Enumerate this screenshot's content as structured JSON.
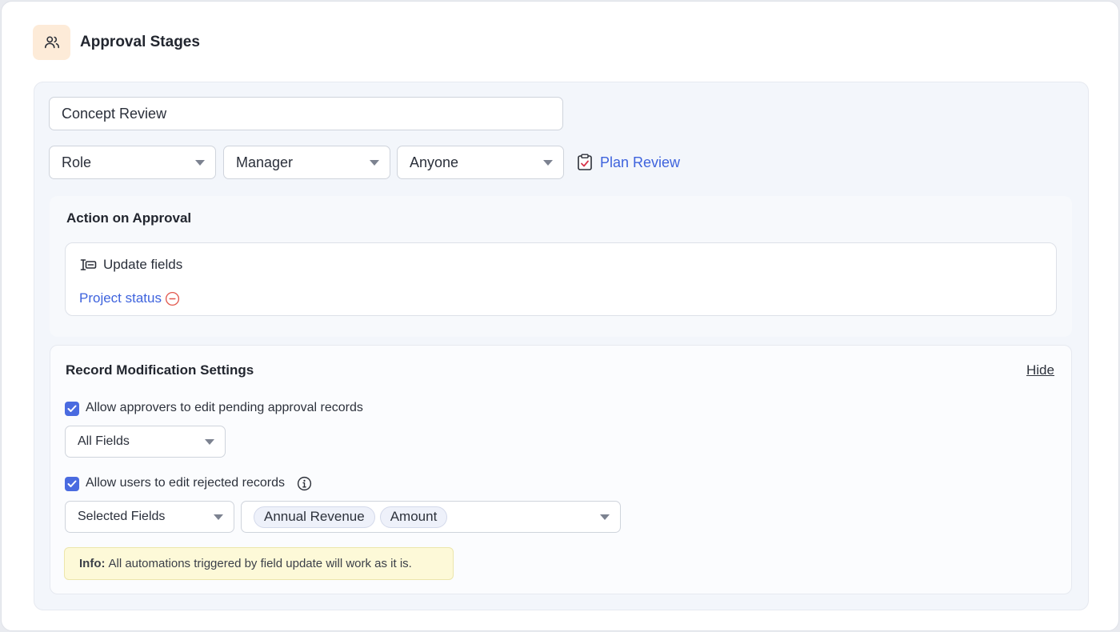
{
  "header": {
    "title": "Approval Stages",
    "icon": "users-icon"
  },
  "stage": {
    "name_value": "Concept Review",
    "approver_type": "Role",
    "approver_role": "Manager",
    "approval_rule": "Anyone",
    "plan_review_label": "Plan Review"
  },
  "action_on_approval": {
    "title": "Action on Approval",
    "action_label": "Update fields",
    "field_link": "Project status"
  },
  "record_modification": {
    "title": "Record Modification Settings",
    "hide_label": "Hide",
    "allow_approvers_label": "Allow approvers to edit pending approval records",
    "allow_approvers_checked": true,
    "approvers_fields": "All Fields",
    "allow_users_label": "Allow users to edit rejected records",
    "allow_users_checked": true,
    "users_fields_mode": "Selected Fields",
    "selected_fields": [
      "Annual Revenue",
      "Amount"
    ],
    "info_prefix": "Info:",
    "info_text": "All automations triggered by field update will work as it is."
  },
  "colors": {
    "accent": "#3e63dd",
    "checkbox": "#4a6be0",
    "danger": "#e2574c"
  }
}
